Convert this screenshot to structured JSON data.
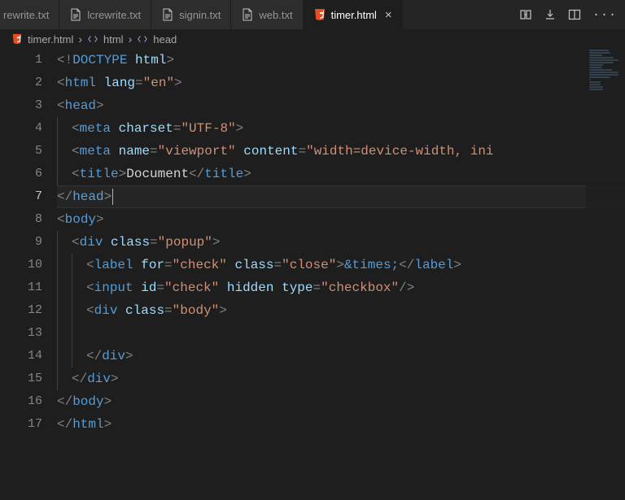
{
  "tabs": [
    {
      "label": "rewrite.txt",
      "type": "text"
    },
    {
      "label": "lcrewrite.txt",
      "type": "text"
    },
    {
      "label": "signin.txt",
      "type": "text"
    },
    {
      "label": "web.txt",
      "type": "text"
    },
    {
      "label": "timer.html",
      "type": "html",
      "active": true
    }
  ],
  "breadcrumb": {
    "file": "timer.html",
    "path": [
      "html",
      "head"
    ]
  },
  "activeLine": 7,
  "lineCount": 17,
  "code": [
    [
      [
        "del",
        "<!"
      ],
      [
        "doc",
        "DOCTYPE"
      ],
      [
        "txt",
        " "
      ],
      [
        "attr",
        "html"
      ],
      [
        "del",
        ">"
      ]
    ],
    [
      [
        "del",
        "<"
      ],
      [
        "tag",
        "html"
      ],
      [
        "txt",
        " "
      ],
      [
        "attr",
        "lang"
      ],
      [
        "del",
        "="
      ],
      [
        "str",
        "\"en\""
      ],
      [
        "del",
        ">"
      ]
    ],
    [
      [
        "del",
        "<"
      ],
      [
        "tag",
        "head"
      ],
      [
        "del",
        ">"
      ]
    ],
    [
      [
        "guide",
        1
      ],
      [
        "del",
        "<"
      ],
      [
        "tag",
        "meta"
      ],
      [
        "txt",
        " "
      ],
      [
        "attr",
        "charset"
      ],
      [
        "del",
        "="
      ],
      [
        "str",
        "\"UTF-8\""
      ],
      [
        "del",
        ">"
      ]
    ],
    [
      [
        "guide",
        1
      ],
      [
        "del",
        "<"
      ],
      [
        "tag",
        "meta"
      ],
      [
        "txt",
        " "
      ],
      [
        "attr",
        "name"
      ],
      [
        "del",
        "="
      ],
      [
        "str",
        "\"viewport\""
      ],
      [
        "txt",
        " "
      ],
      [
        "attr",
        "content"
      ],
      [
        "del",
        "="
      ],
      [
        "str",
        "\"width=device-width, ini"
      ]
    ],
    [
      [
        "guide",
        1
      ],
      [
        "del",
        "<"
      ],
      [
        "tag",
        "title"
      ],
      [
        "del",
        ">"
      ],
      [
        "txt",
        "Document"
      ],
      [
        "del",
        "</"
      ],
      [
        "tag",
        "title"
      ],
      [
        "del",
        ">"
      ]
    ],
    [
      [
        "del",
        "</"
      ],
      [
        "tag",
        "head"
      ],
      [
        "del",
        ">"
      ],
      [
        "cursor",
        ""
      ]
    ],
    [
      [
        "del",
        "<"
      ],
      [
        "tag",
        "body"
      ],
      [
        "del",
        ">"
      ]
    ],
    [
      [
        "guide",
        1
      ],
      [
        "del",
        "<"
      ],
      [
        "tag",
        "div"
      ],
      [
        "txt",
        " "
      ],
      [
        "attr",
        "class"
      ],
      [
        "del",
        "="
      ],
      [
        "str",
        "\"popup\""
      ],
      [
        "del",
        ">"
      ]
    ],
    [
      [
        "guide",
        1
      ],
      [
        "guide",
        1
      ],
      [
        "del",
        "<"
      ],
      [
        "tag",
        "label"
      ],
      [
        "txt",
        " "
      ],
      [
        "attr",
        "for"
      ],
      [
        "del",
        "="
      ],
      [
        "str",
        "\"check\""
      ],
      [
        "txt",
        " "
      ],
      [
        "attr",
        "class"
      ],
      [
        "del",
        "="
      ],
      [
        "str",
        "\"close\""
      ],
      [
        "del",
        ">"
      ],
      [
        "ent",
        "&times;"
      ],
      [
        "del",
        "</"
      ],
      [
        "tag",
        "label"
      ],
      [
        "del",
        ">"
      ]
    ],
    [
      [
        "guide",
        1
      ],
      [
        "guide",
        1
      ],
      [
        "del",
        "<"
      ],
      [
        "tag",
        "input"
      ],
      [
        "txt",
        " "
      ],
      [
        "attr",
        "id"
      ],
      [
        "del",
        "="
      ],
      [
        "str",
        "\"check\""
      ],
      [
        "txt",
        " "
      ],
      [
        "attr",
        "hidden"
      ],
      [
        "txt",
        " "
      ],
      [
        "attr",
        "type"
      ],
      [
        "del",
        "="
      ],
      [
        "str",
        "\"checkbox\""
      ],
      [
        "del",
        "/>"
      ]
    ],
    [
      [
        "guide",
        1
      ],
      [
        "guide",
        1
      ],
      [
        "del",
        "<"
      ],
      [
        "tag",
        "div"
      ],
      [
        "txt",
        " "
      ],
      [
        "attr",
        "class"
      ],
      [
        "del",
        "="
      ],
      [
        "str",
        "\"body\""
      ],
      [
        "del",
        ">"
      ]
    ],
    [
      [
        "guide",
        1
      ],
      [
        "guide",
        1
      ]
    ],
    [
      [
        "guide",
        1
      ],
      [
        "guide",
        1
      ],
      [
        "del",
        "</"
      ],
      [
        "tag",
        "div"
      ],
      [
        "del",
        ">"
      ]
    ],
    [
      [
        "guide",
        1
      ],
      [
        "del",
        "</"
      ],
      [
        "tag",
        "div"
      ],
      [
        "del",
        ">"
      ]
    ],
    [
      [
        "del",
        "</"
      ],
      [
        "tag",
        "body"
      ],
      [
        "del",
        ">"
      ]
    ],
    [
      [
        "del",
        "</"
      ],
      [
        "tag",
        "html"
      ],
      [
        "del",
        ">"
      ]
    ]
  ]
}
